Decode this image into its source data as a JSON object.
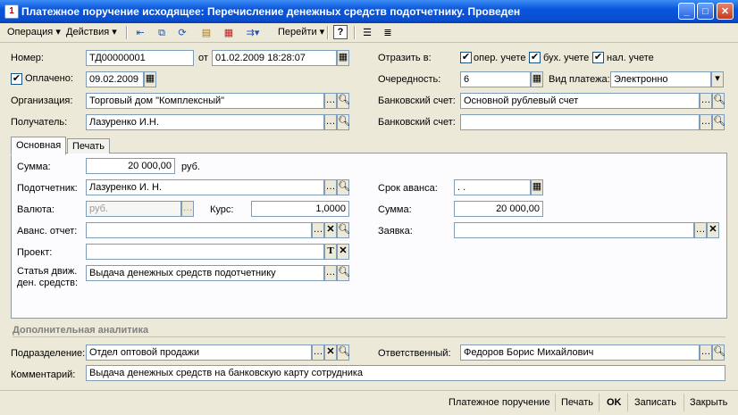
{
  "window": {
    "title": "Платежное поручение исходящее: Перечисление денежных средств подотчетнику. Проведен"
  },
  "toolbar": {
    "operation": "Операция",
    "actions": "Действия",
    "goto": "Перейти",
    "help": "?"
  },
  "header": {
    "number_label": "Номер:",
    "number_value": "ТД00000001",
    "from_label": "от",
    "date_value": "01.02.2009 18:28:07",
    "paid_label": "Оплачено:",
    "paid_checked": true,
    "paid_date": "09.02.2009",
    "org_label": "Организация:",
    "org_value": "Торговый дом \"Комплексный\"",
    "recipient_label": "Получатель:",
    "recipient_value": "Лазуренко И.Н.",
    "reflect_label": "Отразить в:",
    "reflect_oper": "опер. учете",
    "reflect_buh": "бух. учете",
    "reflect_nal": "нал. учете",
    "priority_label": "Очередность:",
    "priority_value": "6",
    "payment_type_label": "Вид платежа:",
    "payment_type_value": "Электронно",
    "bank_account_label": "Банковский счет:",
    "bank_account_value": "Основной рублевый счет",
    "bank_account2_label": "Банковский счет:",
    "bank_account2_value": ""
  },
  "tabs": {
    "main": "Основная",
    "print": "Печать"
  },
  "main_tab": {
    "sum_label": "Сумма:",
    "sum_value": "20 000,00",
    "currency_unit": "руб.",
    "accountable_label": "Подотчетник:",
    "accountable_value": "Лазуренко И. Н.",
    "currency_label": "Валюта:",
    "currency_value": "руб.",
    "rate_label": "Курс:",
    "rate_value": "1,0000",
    "advance_report_label": "Аванс. отчет:",
    "advance_report_value": "",
    "project_label": "Проект:",
    "project_value": "",
    "cashflow_label_1": "Статья движ.",
    "cashflow_label_2": "ден. средств:",
    "cashflow_value": "Выдача денежных средств подотчетнику",
    "advance_term_label": "Срок аванса:",
    "advance_term_value": " .  .",
    "sum2_label": "Сумма:",
    "sum2_value": "20 000,00",
    "request_label": "Заявка:",
    "request_value": ""
  },
  "analytics": {
    "section_title": "Дополнительная аналитика",
    "division_label": "Подразделение:",
    "division_value": "Отдел оптовой продажи",
    "responsible_label": "Ответственный:",
    "responsible_value": "Федоров Борис Михайлович",
    "comment_label": "Комментарий:",
    "comment_value": "Выдача денежных средств на банковскую карту сотрудника"
  },
  "footer": {
    "payment_order": "Платежное поручение",
    "print": "Печать",
    "ok": "OK",
    "save": "Записать",
    "close": "Закрыть"
  },
  "colors": {
    "titlebar": "#0a55dc",
    "window_bg": "#ece9d8",
    "field_border": "#7f9db9"
  }
}
